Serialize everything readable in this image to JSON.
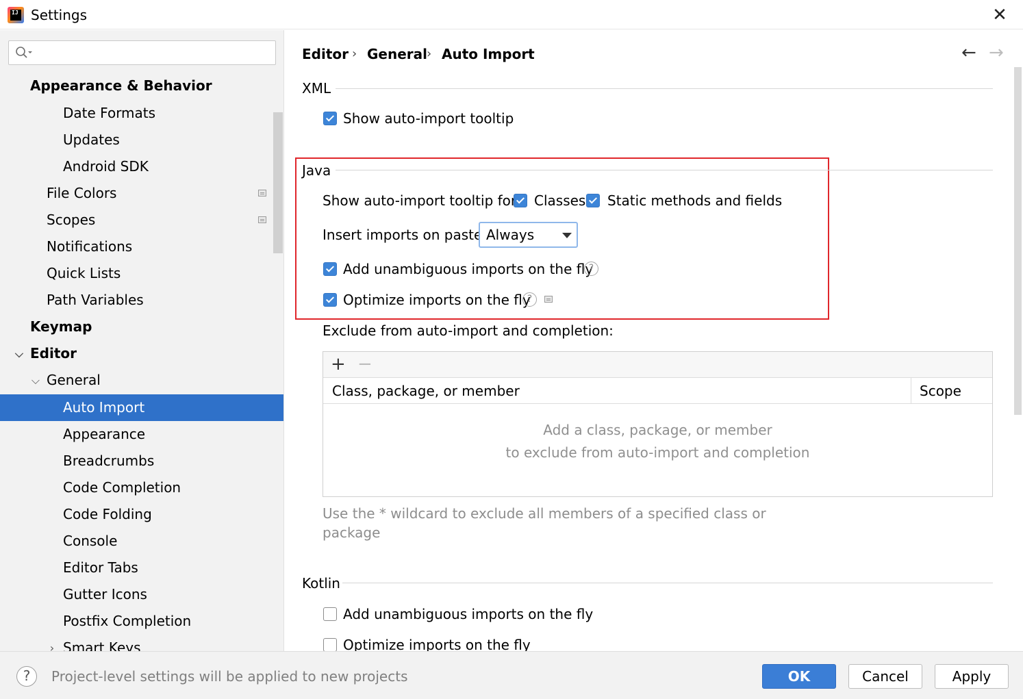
{
  "window": {
    "title": "Settings",
    "close_glyph": "✕"
  },
  "sidebar": {
    "search_placeholder": "",
    "items": [
      {
        "label": "Appearance & Behavior"
      },
      {
        "label": "Date Formats"
      },
      {
        "label": "Updates"
      },
      {
        "label": "Android SDK"
      },
      {
        "label": "File Colors"
      },
      {
        "label": "Scopes"
      },
      {
        "label": "Notifications"
      },
      {
        "label": "Quick Lists"
      },
      {
        "label": "Path Variables"
      },
      {
        "label": "Keymap"
      },
      {
        "label": "Editor"
      },
      {
        "label": "General"
      },
      {
        "label": "Auto Import"
      },
      {
        "label": "Appearance"
      },
      {
        "label": "Breadcrumbs"
      },
      {
        "label": "Code Completion"
      },
      {
        "label": "Code Folding"
      },
      {
        "label": "Console"
      },
      {
        "label": "Editor Tabs"
      },
      {
        "label": "Gutter Icons"
      },
      {
        "label": "Postfix Completion"
      },
      {
        "label": "Smart Keys"
      }
    ],
    "selected": "Auto Import"
  },
  "breadcrumb": [
    "Editor",
    "General",
    "Auto Import"
  ],
  "breadcrumb_sep": "›",
  "nav": {
    "back": "←",
    "forward": "→"
  },
  "xml": {
    "title": "XML",
    "show_tooltip_label": "Show auto-import tooltip",
    "show_tooltip_checked": true
  },
  "java": {
    "title": "Java",
    "tooltip_for_label": "Show auto-import tooltip for:",
    "classes_label": "Classes",
    "classes_checked": true,
    "static_label": "Static methods and fields",
    "static_checked": true,
    "insert_label": "Insert imports on paste:",
    "insert_value": "Always",
    "unambiguous_label": "Add unambiguous imports on the fly",
    "unambiguous_checked": true,
    "optimize_label": "Optimize imports on the fly",
    "optimize_checked": true,
    "help_glyph": "?"
  },
  "exclude": {
    "label": "Exclude from auto-import and completion:",
    "add": "+",
    "remove": "−",
    "col_member": "Class, package, or member",
    "col_scope": "Scope",
    "empty_line1": "Add a class, package, or member",
    "empty_line2": "to exclude from auto-import and completion",
    "hint_line1": "Use the * wildcard to exclude all members of a specified class or",
    "hint_line2": "package"
  },
  "kotlin": {
    "title": "Kotlin",
    "unambiguous_label": "Add unambiguous imports on the fly",
    "unambiguous_checked": false,
    "optimize_label": "Optimize imports on the fly",
    "optimize_checked": false
  },
  "footer": {
    "help_glyph": "?",
    "message": "Project-level settings will be applied to new projects",
    "ok": "OK",
    "cancel": "Cancel",
    "apply": "Apply"
  },
  "colors": {
    "accent": "#2f71c9",
    "highlight_box": "#e0262b",
    "checkbox": "#3d85d8"
  }
}
